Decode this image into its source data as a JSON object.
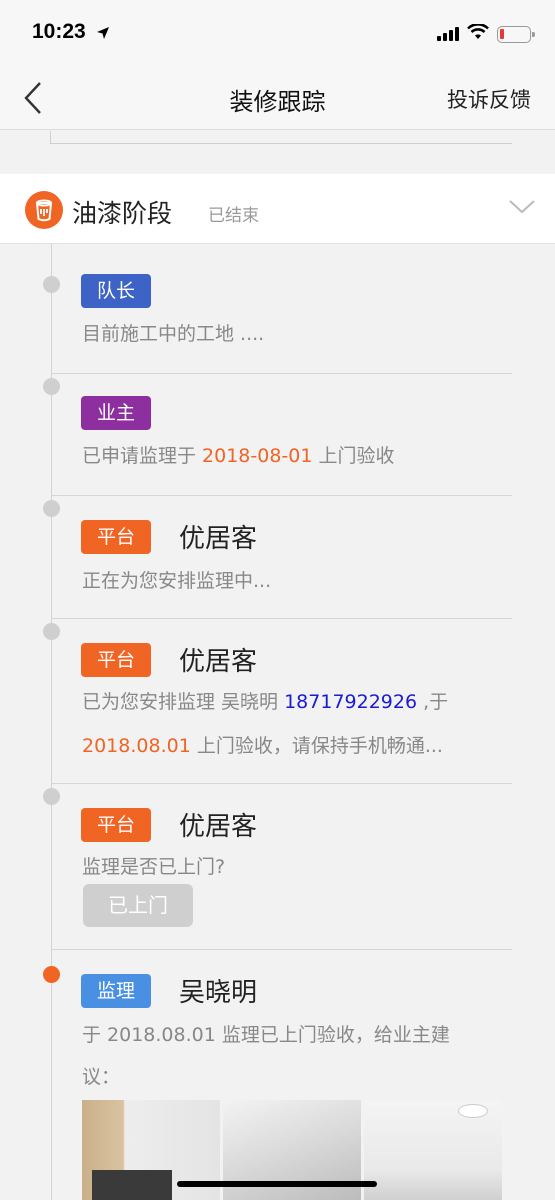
{
  "status_bar": {
    "time": "10:23"
  },
  "nav": {
    "title": "装修跟踪",
    "right_label": "投诉反馈"
  },
  "stage": {
    "title": "油漆阶段",
    "status": "已结束"
  },
  "entries": [
    {
      "badge": "队长",
      "message": "目前施工中的工地 ...."
    },
    {
      "badge": "业主",
      "msg_pre": "已申请监理于 ",
      "msg_date": "2018-08-01",
      "msg_post": " 上门验收"
    },
    {
      "badge": "平台",
      "sender": "优居客",
      "message": "正在为您安排监理中..."
    },
    {
      "badge": "平台",
      "sender": "优居客",
      "line1_pre": "已为您安排监理 吴晓明 ",
      "phone": "18717922926",
      "line1_post": " ,于",
      "line2_date": "2018.08.01",
      "line2_post": " 上门验收，请保持手机畅通..."
    },
    {
      "badge": "平台",
      "sender": "优居客",
      "message": "监理是否已上门?",
      "button": "已上门"
    },
    {
      "badge": "监理",
      "sender": "吴晓明",
      "line1": "于 2018.08.01 监理已上门验收，给业主建",
      "line2": "议："
    }
  ],
  "colors": {
    "accent": "#f06424",
    "leader": "#3d63c6",
    "owner": "#8d2f9e",
    "supervisor": "#4a90e2",
    "phone": "#1a1ad6"
  },
  "icons": {
    "back": "chevron-left-icon",
    "expand": "chevron-down-icon",
    "stage": "paint-bucket-icon"
  }
}
